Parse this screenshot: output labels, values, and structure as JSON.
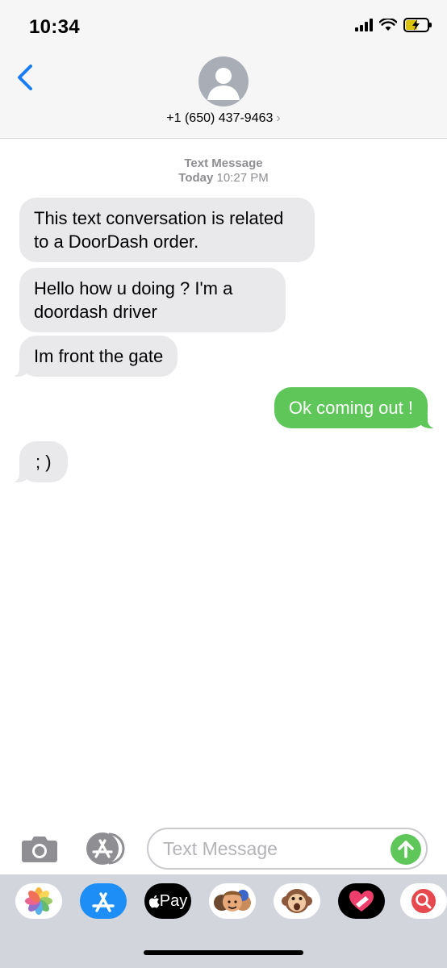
{
  "status_bar": {
    "time": "10:34"
  },
  "header": {
    "contact": "+1 (650) 437-9463",
    "chevron": "›"
  },
  "conversation": {
    "service": "Text Message",
    "day": "Today",
    "time": "10:27 PM",
    "messages": [
      {
        "direction": "incoming",
        "text": "This text conversation is related to a DoorDash order."
      },
      {
        "direction": "incoming",
        "text": "Hello how u doing ? I'm a doordash driver"
      },
      {
        "direction": "incoming",
        "text": "Im front the gate"
      },
      {
        "direction": "outgoing",
        "text": "Ok coming out !"
      },
      {
        "direction": "incoming",
        "text": "; )"
      }
    ]
  },
  "composer": {
    "placeholder": "Text Message"
  },
  "app_drawer": {
    "apple_pay_label": "Pay",
    "apps": [
      "photos-icon",
      "app-store-icon",
      "apple-pay-icon",
      "memoji-icon",
      "animoji-monkey-icon",
      "digital-touch-icon",
      "search-images-icon"
    ]
  },
  "colors": {
    "accent_blue": "#1a7cf5",
    "outgoing_green": "#5fc65a",
    "incoming_gray": "#e9e9eb"
  }
}
